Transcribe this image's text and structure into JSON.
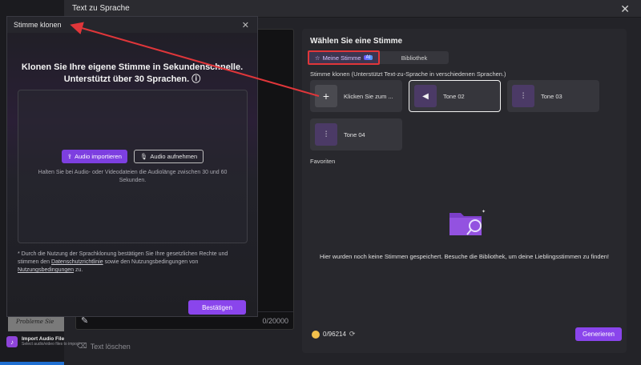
{
  "main": {
    "title": "Text zu Sprache",
    "close_icon": "close-icon",
    "editor": {
      "counter": "0/20000",
      "delete_label": "Text löschen"
    }
  },
  "voice_panel": {
    "title": "Wählen Sie eine Stimme",
    "tabs": [
      {
        "label": "Meine Stimme",
        "badge": "AI"
      },
      {
        "label": "Bibliothek"
      }
    ],
    "clone_label": "Stimme klonen (Unterstützt Text-zu-Sprache in verschiedenen Sprachen.)",
    "voices": [
      {
        "label": "Klicken Sie zum ...",
        "icon": "plus-icon"
      },
      {
        "label": "Tone 02",
        "icon": "voice-wave-icon"
      },
      {
        "label": "Tone 03",
        "icon": "voice-wave-icon"
      },
      {
        "label": "Tone 04",
        "icon": "voice-wave-icon"
      }
    ],
    "favorites_label": "Favoriten",
    "empty_text": "Hier wurden noch keine Stimmen gespeichert. Besuche die Bibliothek, um deine Lieblingsstimmen zu finden!",
    "credits": "0/96214",
    "generate_label": "Generieren",
    "colors": {
      "accent": "#8a45ec",
      "highlight": "#e0363a"
    }
  },
  "clone_dialog": {
    "title": "Stimme klonen",
    "headline_1": "Klonen Sie Ihre eigene Stimme in Sekundenschnelle.",
    "headline_2": "Unterstützt über 30 Sprachen.",
    "import_label": "Audio importieren",
    "record_label": "Audio aufnehmen",
    "hint": "Halten Sie bei Audio- oder Videodateien die Audiolänge zwischen 30 und 60 Sekunden.",
    "disclaimer_1": "* Durch die Nutzung der Sprachklonung bestätigen Sie Ihre gesetzlichen Rechte und stimmen den",
    "privacy_link": "Datenschutzrichtlinie",
    "disclaimer_2": "sowie den Nutzungsbedingungen von",
    "terms_link": "Nutzungsbedingungen",
    "disclaimer_3": "zu.",
    "confirm_label": "Bestätigen"
  },
  "background": {
    "thumb_text": "Probleme Sie",
    "import_title": "Import Audio File",
    "import_sub": "Select audio/video files to import"
  }
}
